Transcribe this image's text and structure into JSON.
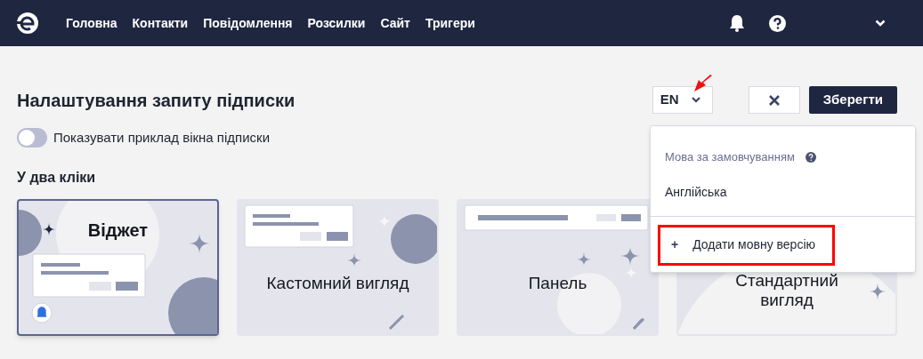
{
  "nav": {
    "items": [
      {
        "label": "Головна"
      },
      {
        "label": "Контакти"
      },
      {
        "label": "Повідомлення"
      },
      {
        "label": "Розсилки"
      },
      {
        "label": "Сайт"
      },
      {
        "label": "Тригери"
      }
    ]
  },
  "header": {
    "title": "Налаштування запиту підписки",
    "language": "EN",
    "save": "Зберегти"
  },
  "toggle": {
    "label": "Показувати приклад вікна підписки",
    "on": false
  },
  "language_menu": {
    "open": true,
    "section_label": "Мова за замовчуванням",
    "default_language": "Англійська",
    "add_icon": "+",
    "add_label": "Додати мовну версію",
    "highlighted": true
  },
  "section": {
    "title": "У два кліки"
  },
  "cards": [
    {
      "kind": "widget",
      "label": "Віджет",
      "selected": true
    },
    {
      "kind": "custom",
      "label": "Кастомний вигляд",
      "selected": false
    },
    {
      "kind": "panel",
      "label": "Панель",
      "selected": false
    },
    {
      "kind": "standard",
      "label": "Стандартний вигляд",
      "selected": false
    }
  ]
}
